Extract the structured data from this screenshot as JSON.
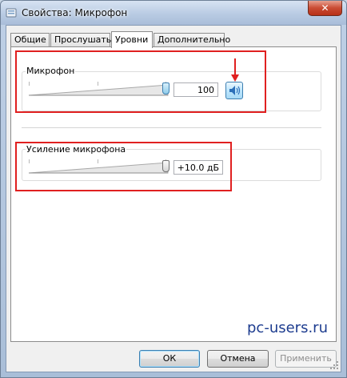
{
  "window": {
    "title": "Свойства: Микрофон",
    "close_label": "✕"
  },
  "tabs": [
    {
      "label": "Общие",
      "active": false
    },
    {
      "label": "Прослушать",
      "active": false
    },
    {
      "label": "Уровни",
      "active": true
    },
    {
      "label": "Дополнительно",
      "active": false
    }
  ],
  "microphone": {
    "label": "Микрофон",
    "value": "100",
    "level_fraction": 1.0,
    "mute_icon": "speaker-icon"
  },
  "boost": {
    "label": "Усиление микрофона",
    "value": "+10.0 дБ",
    "level_fraction": 1.0
  },
  "watermark": "pc-users.ru",
  "buttons": {
    "ok": "ОК",
    "cancel": "Отмена",
    "apply": "Применить"
  },
  "colors": {
    "highlight": "#e02020",
    "arrow": "#e02020",
    "watermark": "#1d3c8f"
  }
}
